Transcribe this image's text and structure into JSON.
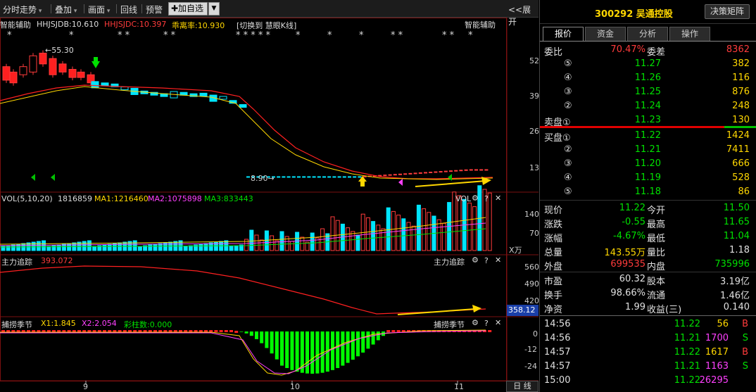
{
  "toolbar": {
    "time_chart": "分时走势",
    "overlay": "叠加",
    "draw": "画面",
    "playback": "回线",
    "alert": "预警",
    "add_watch": "✚加自选",
    "expand": "<<展开"
  },
  "main_panel": {
    "indicator_name": "智能辅助",
    "hhjsjdb": "HHJSJDB:10.610",
    "hhjsjdc": "HHJSJDC:10.397",
    "deviation": "乖离率:10.930",
    "switch_text": "[切换到 慧眼K线]",
    "right_title": "智能辅助",
    "high_label": "←55.30",
    "low_label": "8.90→",
    "y_ticks": [
      "52",
      "39",
      "26",
      "13"
    ],
    "star_marks": [
      "*",
      "*",
      "* *",
      "*",
      "* * * * *",
      "*",
      "*",
      "*",
      "*",
      "* *",
      "* *",
      "*",
      "*"
    ]
  },
  "vol_panel": {
    "title": "VOL(5,10,20)",
    "value": "1816859",
    "ma1": "MA1:1216460",
    "ma2": "MA2:1075898",
    "ma3": "MA3:833443",
    "right_label": "VOL",
    "y_ticks": [
      "140",
      "70"
    ],
    "unit": "X万"
  },
  "zl_panel": {
    "title": "主力追踪",
    "value": "393.072",
    "right_label": "主力追踪",
    "y_ticks": [
      "560",
      "490",
      "420"
    ],
    "current": "358.12"
  },
  "bl_panel": {
    "title": "捕捞季节",
    "x1": "X1:1.845",
    "x2": "X2:2.054",
    "bars": "彩柱数:0.000",
    "right_label": "捕捞季节",
    "y_ticks": [
      "0",
      "-12",
      "-24"
    ]
  },
  "x_axis": {
    "labels": [
      "9",
      "10",
      "11"
    ],
    "period": "日 线"
  },
  "stock": {
    "code_name": "300292 吴通控股",
    "button": "决策矩阵"
  },
  "tabs": [
    "报价",
    "资金",
    "分析",
    "操作"
  ],
  "order_book": {
    "ratio_label": "委比",
    "ratio_value": "70.47%",
    "diff_label": "委差",
    "diff_value": "8362",
    "sell": [
      {
        "label": "⑤",
        "price": "11.27",
        "vol": "382"
      },
      {
        "label": "④",
        "price": "11.26",
        "vol": "116"
      },
      {
        "label": "③",
        "price": "11.25",
        "vol": "876"
      },
      {
        "label": "②",
        "price": "11.24",
        "vol": "248"
      },
      {
        "label": "卖盘①",
        "price": "11.23",
        "vol": "130"
      }
    ],
    "buy": [
      {
        "label": "买盘①",
        "price": "11.22",
        "vol": "1424"
      },
      {
        "label": "②",
        "price": "11.21",
        "vol": "7411"
      },
      {
        "label": "③",
        "price": "11.20",
        "vol": "666"
      },
      {
        "label": "④",
        "price": "11.19",
        "vol": "528"
      },
      {
        "label": "⑤",
        "price": "11.18",
        "vol": "86"
      }
    ]
  },
  "quote": [
    {
      "l1": "现价",
      "v1": "11.22",
      "c1": "green",
      "l2": "今开",
      "v2": "11.50",
      "c2": "green"
    },
    {
      "l1": "涨跌",
      "v1": "-0.55",
      "c1": "green",
      "l2": "最高",
      "v2": "11.65",
      "c2": "green"
    },
    {
      "l1": "涨幅",
      "v1": "-4.67%",
      "c1": "green",
      "l2": "最低",
      "v2": "11.04",
      "c2": "green"
    },
    {
      "l1": "总量",
      "v1": "143.55万",
      "c1": "yel",
      "l2": "量比",
      "v2": "1.18",
      "c2": "wht"
    },
    {
      "l1": "外盘",
      "v1": "699535",
      "c1": "red",
      "l2": "内盘",
      "v2": "735996",
      "c2": "green"
    },
    {
      "l1": "市盈",
      "v1": "60.32",
      "c1": "wht",
      "l2": "股本",
      "v2": "3.19亿",
      "c2": "wht"
    },
    {
      "l1": "换手",
      "v1": "98.66%",
      "c1": "wht",
      "l2": "流通",
      "v2": "1.46亿",
      "c2": "wht"
    },
    {
      "l1": "净资",
      "v1": "1.99",
      "c1": "wht",
      "l2": "收益(三)",
      "v2": "0.140",
      "c2": "wht"
    }
  ],
  "ticks": [
    {
      "time": "14:56",
      "price": "11.22",
      "vol": "56",
      "side": "B"
    },
    {
      "time": "14:56",
      "price": "11.21",
      "vol": "1700",
      "side": "S"
    },
    {
      "time": "14:57",
      "price": "11.22",
      "vol": "1617",
      "side": "B"
    },
    {
      "time": "14:57",
      "price": "11.21",
      "vol": "1163",
      "side": "S"
    },
    {
      "time": "15:00",
      "price": "11.22",
      "vol": "26295",
      "side": ""
    }
  ],
  "colors": {
    "up": "#ff3b3b",
    "down": "#00e5ff",
    "accent": "#ffd700"
  }
}
